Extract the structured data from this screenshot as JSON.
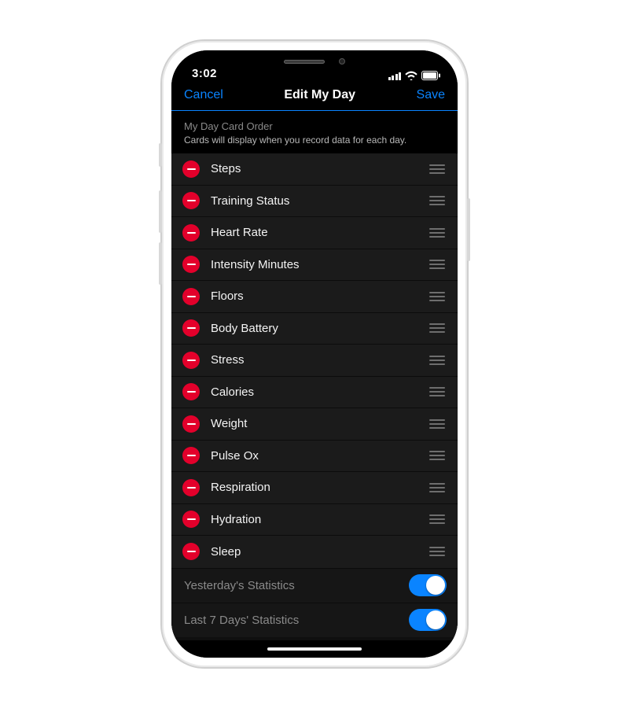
{
  "status": {
    "time": "3:02"
  },
  "nav": {
    "cancel": "Cancel",
    "title": "Edit My Day",
    "save": "Save"
  },
  "section": {
    "title": "My Day Card Order",
    "subtitle": "Cards will display when you record data for each day."
  },
  "cards": [
    {
      "label": "Steps"
    },
    {
      "label": "Training Status"
    },
    {
      "label": "Heart Rate"
    },
    {
      "label": "Intensity Minutes"
    },
    {
      "label": "Floors"
    },
    {
      "label": "Body Battery"
    },
    {
      "label": "Stress"
    },
    {
      "label": "Calories"
    },
    {
      "label": "Weight"
    },
    {
      "label": "Pulse Ox"
    },
    {
      "label": "Respiration"
    },
    {
      "label": "Hydration"
    },
    {
      "label": "Sleep"
    }
  ],
  "toggles": {
    "yesterday": {
      "label": "Yesterday's Statistics",
      "on": true
    },
    "last7": {
      "label": "Last 7 Days' Statistics",
      "on": true
    }
  }
}
